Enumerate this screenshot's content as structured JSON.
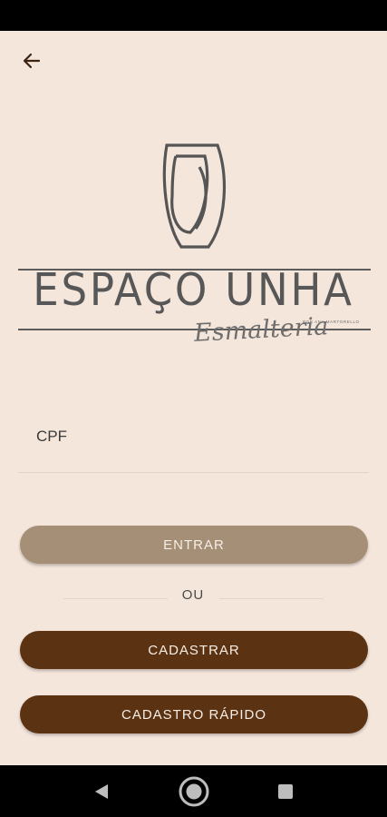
{
  "header": {
    "back_icon": "arrow-left-icon"
  },
  "logo": {
    "brand": "ESPAÇO UNHA",
    "tagline": "POR ANA MARTORELLO",
    "script": "Esmalteria"
  },
  "form": {
    "cpf_placeholder": "CPF",
    "cpf_value": ""
  },
  "buttons": {
    "entrar": "ENTRAR",
    "divider": "OU",
    "cadastrar": "CADASTRAR",
    "cadastro_rapido": "CADASTRO RÁPIDO"
  },
  "nav": {
    "back_icon": "triangle-back-icon",
    "home_icon": "circle-home-icon",
    "recents_icon": "square-recents-icon"
  },
  "colors": {
    "background": "#f5e6dc",
    "primary_light": "#a58f76",
    "primary_dark": "#5c3312",
    "logo_gray": "#575757"
  }
}
